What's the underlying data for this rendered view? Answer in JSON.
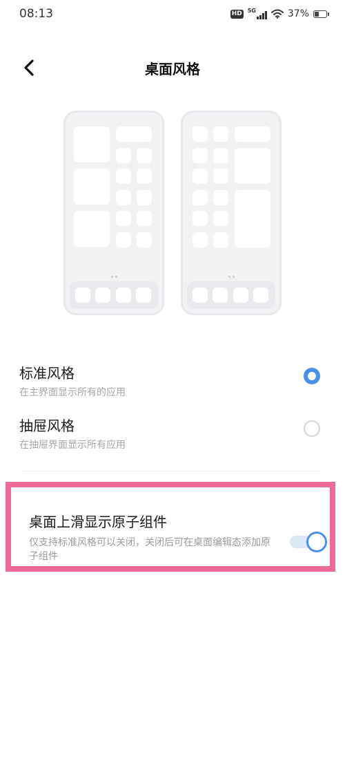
{
  "status_bar": {
    "time": "08:13",
    "hd_label": "HD",
    "network_label": "5G",
    "battery_percent": "37%",
    "battery_level": 0.37
  },
  "header": {
    "title": "桌面风格",
    "back_icon": "chevron-left-icon"
  },
  "previews": {
    "standard": {
      "style": "standard-layout-preview"
    },
    "drawer": {
      "style": "drawer-layout-preview"
    }
  },
  "options": [
    {
      "title": "标准风格",
      "desc": "在主界面显示所有的应用",
      "selected": true
    },
    {
      "title": "抽屉风格",
      "desc": "在抽屉界面显示所有应用",
      "selected": false
    }
  ],
  "atom_widget": {
    "title": "桌面上滑显示原子组件",
    "desc": "仅支持标准风格可以关闭，关闭后可在桌面编辑态添加原子组件",
    "enabled": true
  },
  "colors": {
    "accent": "#4a90e8",
    "highlight": "#ef6a96"
  }
}
